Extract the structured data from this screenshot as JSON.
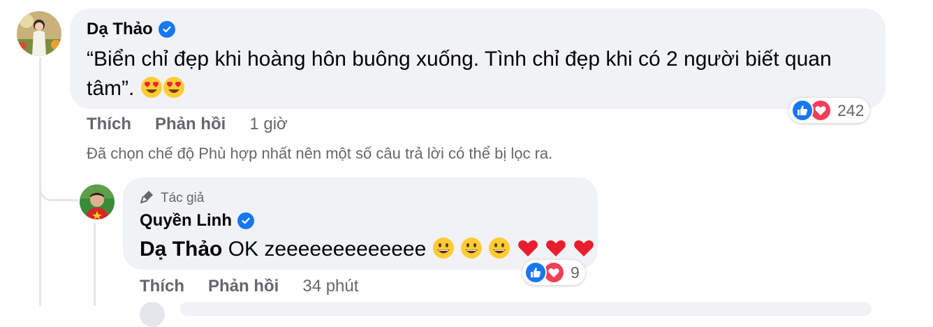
{
  "comment": {
    "author": "Dạ Thảo",
    "text": "“Biển chỉ đẹp khi hoàng hôn buông xuống. Tình chỉ đẹp khi có 2 người biết quan tâm”.",
    "like_label": "Thích",
    "reply_label": "Phản hồi",
    "time": "1 giờ",
    "reaction_count": "242"
  },
  "filter_notice": "Đã chọn chế độ Phù hợp nhất nên một số câu trả lời có thể bị lọc ra.",
  "reply": {
    "badge": "Tác giả",
    "author": "Quyền Linh",
    "mention": "Dạ Thảo",
    "text": "OK zeeeeeeeeeeeee",
    "like_label": "Thích",
    "reply_label": "Phản hồi",
    "time": "34 phút",
    "reaction_count": "9"
  },
  "icons": {
    "verified": "verified-badge-icon",
    "like": "like-reaction-icon",
    "love": "love-reaction-icon",
    "author": "microphone-icon"
  },
  "colors": {
    "bubble": "#f0f2f5",
    "secondary_text": "#65676b",
    "verified": "#1877f2",
    "like": "#1877f2",
    "love": "#f33e58"
  }
}
